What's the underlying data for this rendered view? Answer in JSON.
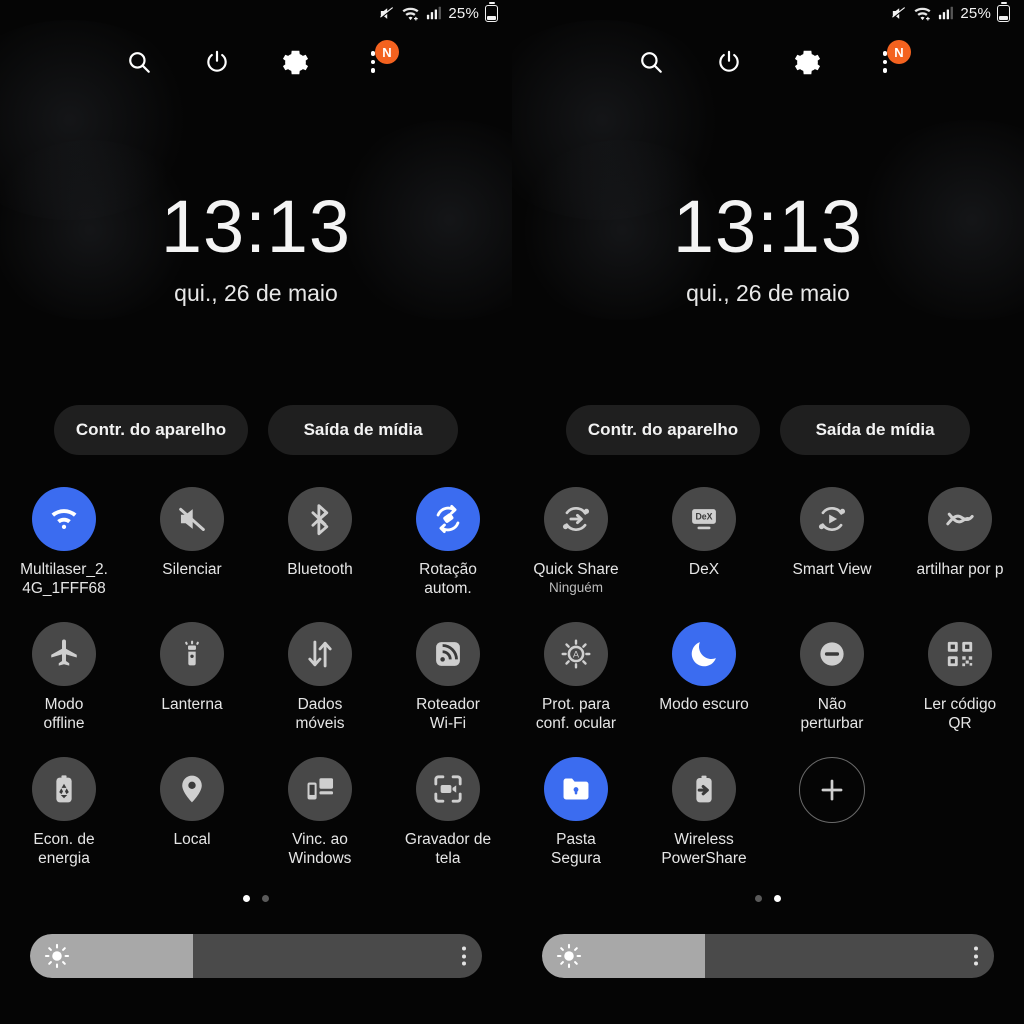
{
  "status_bar": {
    "icons": [
      "mute-icon",
      "wifi-plus-icon",
      "signal-bars-icon"
    ],
    "battery_percent": "25%"
  },
  "header": {
    "icons": [
      "search-icon",
      "power-icon",
      "settings-gear-icon",
      "overflow-menu-icon"
    ],
    "badge_label": "N"
  },
  "lockscreen": {
    "time": "13:13",
    "date": "qui., 26 de maio"
  },
  "pills": {
    "device_control": "Contr. do aparelho",
    "media_output": "Saída de mídia"
  },
  "accent_colors": {
    "active_tile": "#3b6cf0",
    "inactive_tile": "#484848",
    "badge": "#f4621f",
    "slider_fill": "#a8a8a8",
    "slider_track": "#4a4a4a",
    "background": "#000000"
  },
  "panels": [
    {
      "page": 1,
      "page_dots": {
        "count": 2,
        "active": 1
      },
      "tiles": [
        {
          "label": "Multilaser_2.\n4G_1FFF68",
          "sub": "",
          "icon": "wifi-icon",
          "active": true
        },
        {
          "label": "Silenciar",
          "sub": "",
          "icon": "mute-speaker-icon",
          "active": false
        },
        {
          "label": "Bluetooth",
          "sub": "",
          "icon": "bluetooth-icon",
          "active": false
        },
        {
          "label": "Rotação\nautom.",
          "sub": "",
          "icon": "auto-rotate-icon",
          "active": true
        },
        {
          "label": "Modo\noffline",
          "sub": "",
          "icon": "airplane-icon",
          "active": false
        },
        {
          "label": "Lanterna",
          "sub": "",
          "icon": "flashlight-icon",
          "active": false
        },
        {
          "label": "Dados\nmóveis",
          "sub": "",
          "icon": "mobile-data-icon",
          "active": false
        },
        {
          "label": "Roteador\nWi-Fi",
          "sub": "",
          "icon": "hotspot-icon",
          "active": false
        },
        {
          "label": "Econ. de\nenergia",
          "sub": "",
          "icon": "power-saving-icon",
          "active": false
        },
        {
          "label": "Local",
          "sub": "",
          "icon": "location-pin-icon",
          "active": false
        },
        {
          "label": "Vinc. ao\nWindows",
          "sub": "",
          "icon": "link-to-windows-icon",
          "active": false
        },
        {
          "label": "Gravador de\ntela",
          "sub": "",
          "icon": "screen-recorder-icon",
          "active": false
        }
      ],
      "brightness_percent": 36
    },
    {
      "page": 2,
      "page_dots": {
        "count": 2,
        "active": 2
      },
      "tiles": [
        {
          "label": "Quick Share",
          "sub": "Ninguém",
          "icon": "quick-share-icon",
          "active": false
        },
        {
          "label": "DeX",
          "sub": "",
          "icon": "dex-icon",
          "active": false
        },
        {
          "label": "Smart View",
          "sub": "",
          "icon": "smart-view-icon",
          "active": false
        },
        {
          "label": "artilhar por p",
          "sub": "",
          "icon": "nearby-share-icon",
          "active": false
        },
        {
          "label": "Prot. para\nconf. ocular",
          "sub": "",
          "icon": "eye-comfort-shield-icon",
          "active": false
        },
        {
          "label": "Modo escuro",
          "sub": "",
          "icon": "dark-mode-moon-icon",
          "active": true
        },
        {
          "label": "Não\nperturbar",
          "sub": "",
          "icon": "do-not-disturb-icon",
          "active": false
        },
        {
          "label": "Ler código\nQR",
          "sub": "",
          "icon": "qr-code-icon",
          "active": false
        },
        {
          "label": "Pasta\nSegura",
          "sub": "",
          "icon": "secure-folder-icon",
          "active": true
        },
        {
          "label": "Wireless\nPowerShare",
          "sub": "",
          "icon": "wireless-powershare-icon",
          "active": false
        },
        {
          "label": "",
          "sub": "",
          "icon": "add-plus-icon",
          "active": false
        }
      ],
      "brightness_percent": 36
    }
  ]
}
